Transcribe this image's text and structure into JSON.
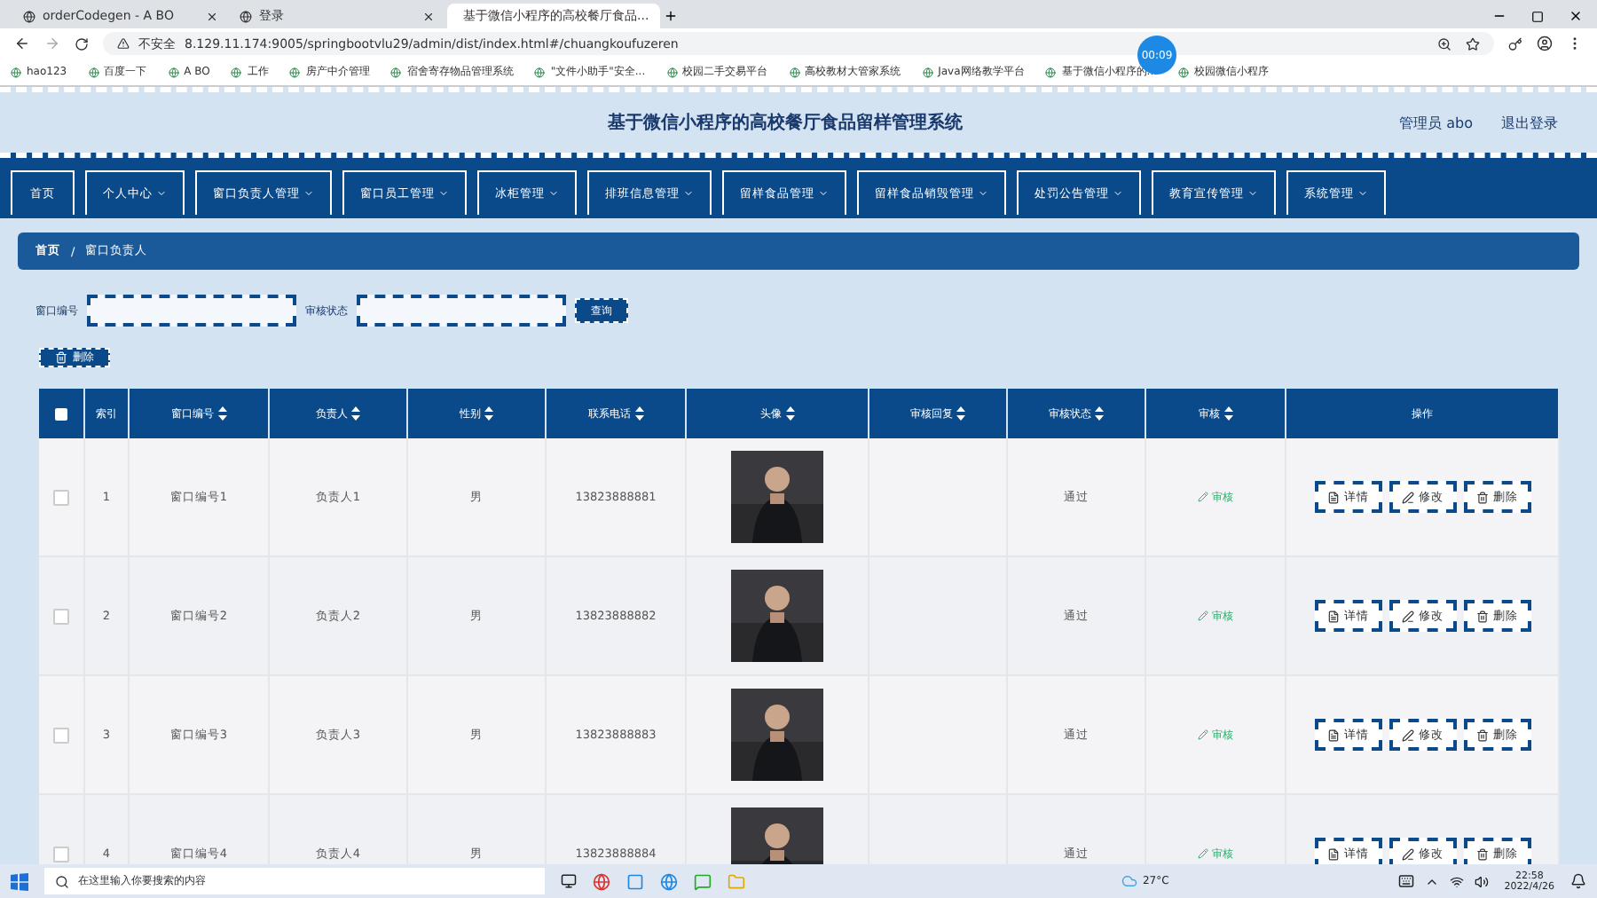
{
  "browser": {
    "tabs": [
      {
        "label": "orderCodegen - A BO",
        "selected": false
      },
      {
        "label": "登录",
        "selected": false
      },
      {
        "label": "基于微信小程序的高校餐厅食品...",
        "selected": true
      }
    ],
    "address": {
      "security": "不安全",
      "url": "8.129.11.174:9005/springbootvlu29/admin/dist/index.html#/chuangkoufuzeren"
    },
    "bookmarks": [
      "hao123",
      "百度一下",
      "A BO",
      "工作",
      "房产中介管理",
      "宿舍寄存物品管理系统",
      "\"文件小助手\"安全...",
      "校园二手交易平台",
      "高校教材大管家系统",
      "Java网络教学平台",
      "基于微信小程序的...",
      "校园微信小程序"
    ],
    "recording_timer": "00:09"
  },
  "header": {
    "title": "基于微信小程序的高校餐厅食品留样管理系统",
    "user": "管理员 abo",
    "logout": "退出登录"
  },
  "nav": [
    {
      "label": "首页",
      "has_menu": false
    },
    {
      "label": "个人中心",
      "has_menu": true
    },
    {
      "label": "窗口负责人管理",
      "has_menu": true
    },
    {
      "label": "窗口员工管理",
      "has_menu": true
    },
    {
      "label": "冰柜管理",
      "has_menu": true
    },
    {
      "label": "排班信息管理",
      "has_menu": true
    },
    {
      "label": "留样食品管理",
      "has_menu": true
    },
    {
      "label": "留样食品销毁管理",
      "has_menu": true
    },
    {
      "label": "处罚公告管理",
      "has_menu": true
    },
    {
      "label": "教育宣传管理",
      "has_menu": true
    },
    {
      "label": "系统管理",
      "has_menu": true
    }
  ],
  "breadcrumb": {
    "items": [
      "首页",
      "窗口负责人"
    ],
    "separator": "/"
  },
  "search": {
    "fields": [
      {
        "label": "窗口编号"
      },
      {
        "label": "审核状态"
      }
    ],
    "button": "查询"
  },
  "delete_button": "删除",
  "table": {
    "select_all_checked": false,
    "columns": [
      {
        "kind": "check"
      },
      {
        "label": "索引",
        "kind": "plain"
      },
      {
        "label": "窗口编号",
        "kind": "sort"
      },
      {
        "label": "负责人",
        "kind": "sort"
      },
      {
        "label": "性别",
        "kind": "sort"
      },
      {
        "label": "联系电话",
        "kind": "sort"
      },
      {
        "label": "头像",
        "kind": "sort"
      },
      {
        "label": "审核回复",
        "kind": "sort"
      },
      {
        "label": "审核状态",
        "kind": "sort"
      },
      {
        "label": "审核",
        "kind": "sort"
      },
      {
        "label": "操作",
        "kind": "plain"
      }
    ],
    "rows": [
      {
        "checked": false,
        "index": "1",
        "window_no": "窗口编号1",
        "manager": "负责人1",
        "gender": "男",
        "phone": "13823888881",
        "status": "通过",
        "review": "审核",
        "actions": [
          "详情",
          "修改",
          "删除"
        ]
      },
      {
        "checked": false,
        "index": "2",
        "window_no": "窗口编号2",
        "manager": "负责人2",
        "gender": "男",
        "phone": "13823888882",
        "status": "通过",
        "review": "审核",
        "actions": [
          "详情",
          "修改",
          "删除"
        ]
      },
      {
        "checked": false,
        "index": "3",
        "window_no": "窗口编号3",
        "manager": "负责人3",
        "gender": "男",
        "phone": "13823888883",
        "status": "通过",
        "review": "审核",
        "actions": [
          "详情",
          "修改",
          "删除"
        ]
      },
      {
        "checked": false,
        "index": "4",
        "window_no": "窗口编号4",
        "manager": "负责人4",
        "gender": "男",
        "phone": "13823888884",
        "status": "通过",
        "review": "审核",
        "actions": [
          "详情",
          "修改",
          "删除"
        ]
      }
    ]
  },
  "taskbar": {
    "search_placeholder": "在这里输入你要搜索的内容",
    "weather": "27°C",
    "time": "22:58",
    "date": "2022/4/26"
  }
}
